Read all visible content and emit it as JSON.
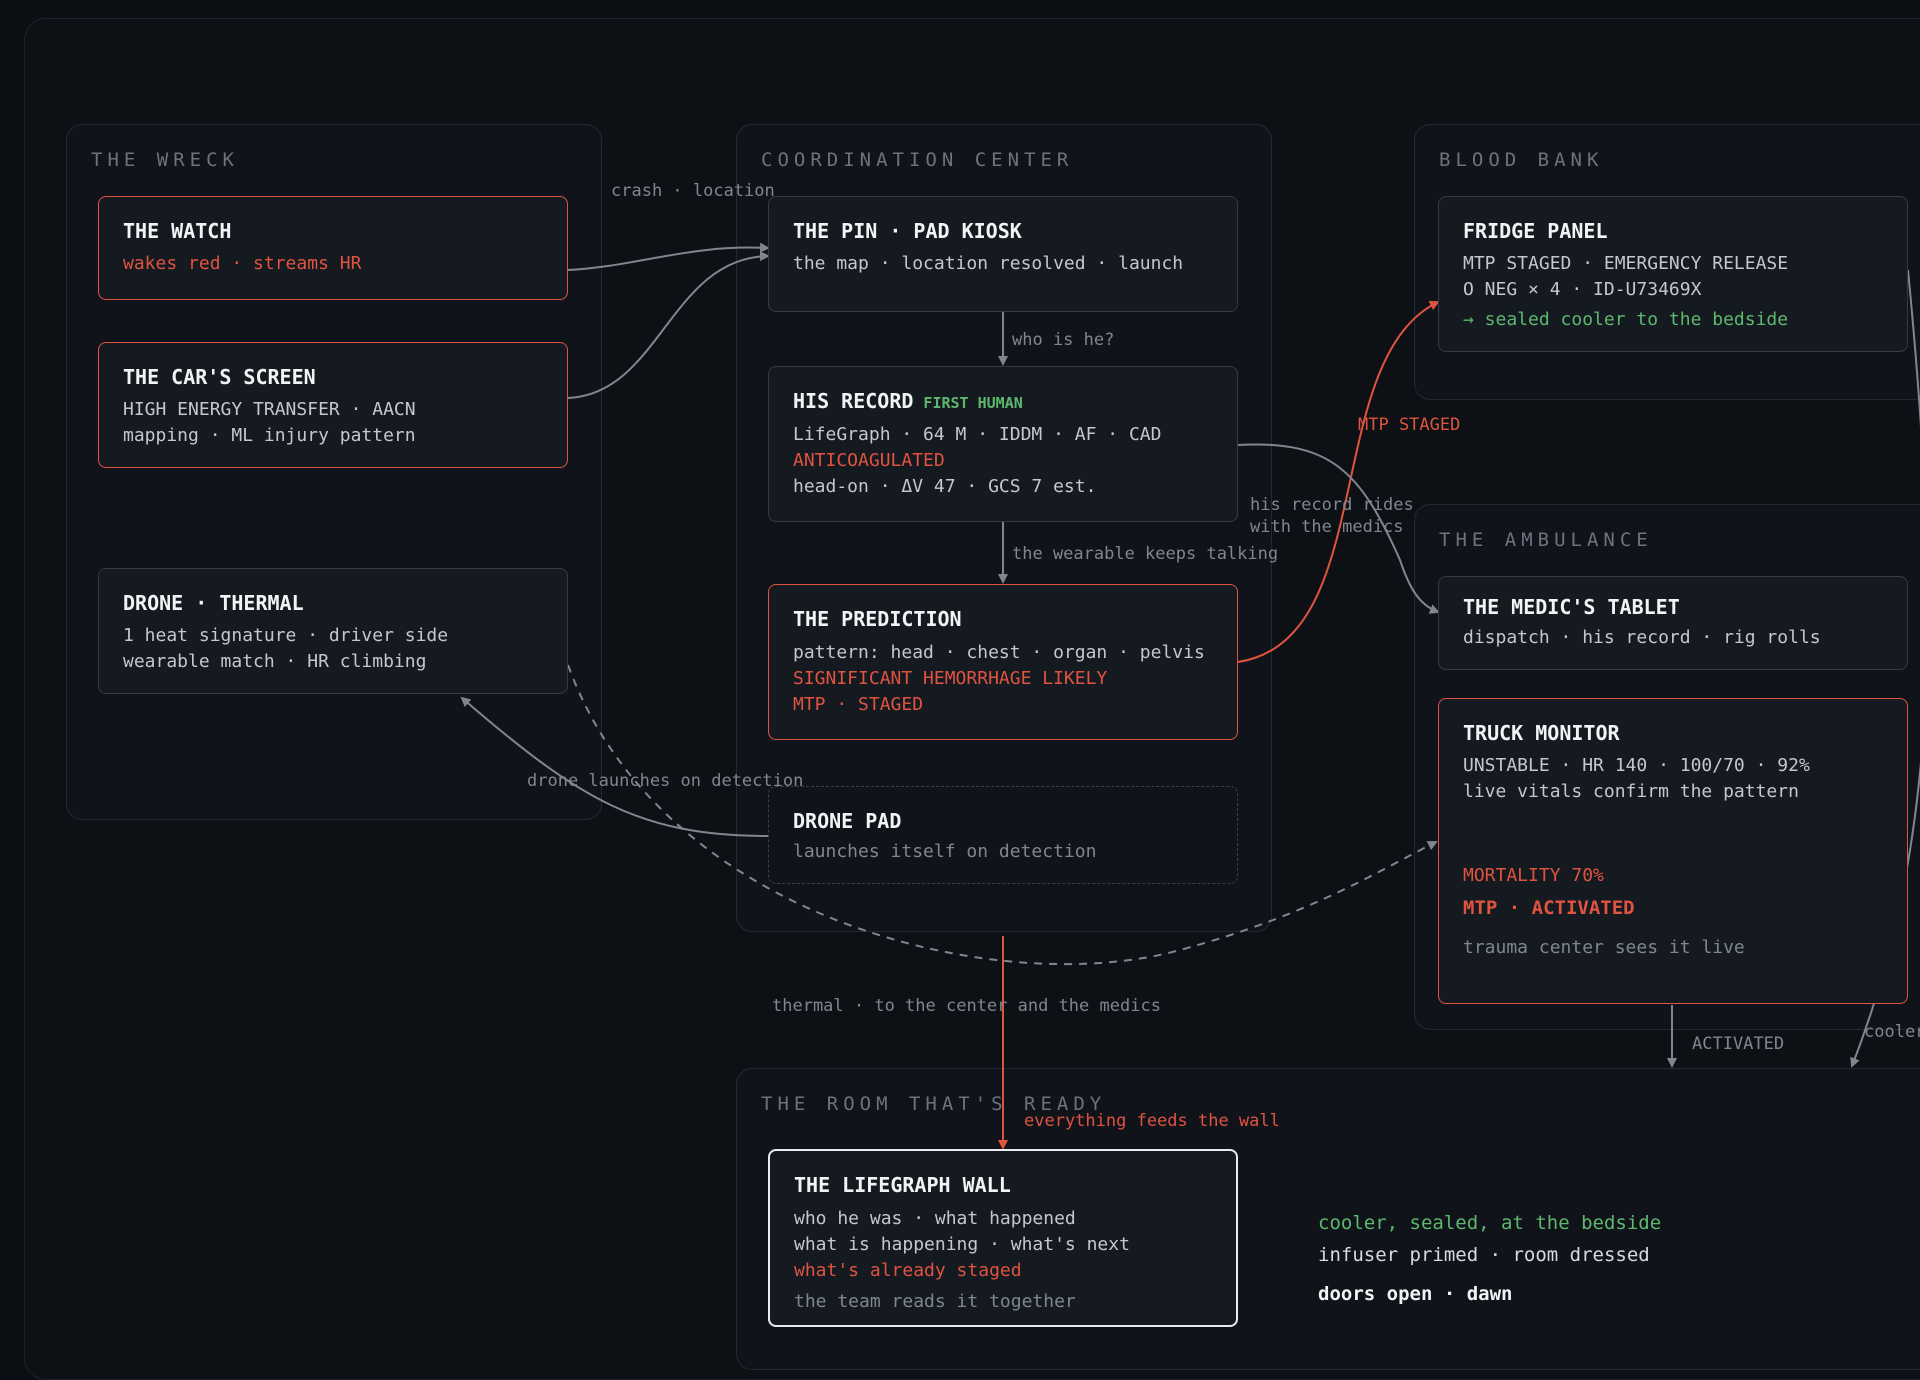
{
  "groups": {
    "wreck": "THE WRECK",
    "coordination": "COORDINATION CENTER",
    "blood_bank": "BLOOD BANK",
    "ambulance": "THE AMBULANCE",
    "room": "THE ROOM THAT'S READY"
  },
  "nodes": {
    "watch": {
      "title": "THE WATCH",
      "line1": "wakes red · streams HR"
    },
    "car_screen": {
      "title": "THE CAR'S SCREEN",
      "line1": "HIGH ENERGY TRANSFER · AACN",
      "line2": "mapping · ML injury pattern"
    },
    "drone_thermal": {
      "title": "DRONE · THERMAL",
      "line1": "1 heat signature · driver side",
      "line2": "wearable match · HR climbing"
    },
    "pin_kiosk": {
      "title": "THE PIN · PAD KIOSK",
      "line1": "the map · location resolved · launch"
    },
    "his_record": {
      "title": "HIS RECORD",
      "tag": "FIRST HUMAN",
      "line1": "LifeGraph · 64 M · IDDM · AF · CAD",
      "line2": "ANTICOAGULATED",
      "line3": "head-on · ΔV 47 · GCS 7 est."
    },
    "prediction": {
      "title": "THE PREDICTION",
      "line1": "pattern: head · chest · organ · pelvis",
      "line2": "SIGNIFICANT HEMORRHAGE LIKELY",
      "line3": "MTP · STAGED"
    },
    "drone_pad": {
      "title": "DRONE PAD",
      "line1": "launches itself on detection"
    },
    "fridge": {
      "title": "FRIDGE PANEL",
      "line1": "MTP STAGED · EMERGENCY RELEASE",
      "line2": "O NEG × 4 · ID-U73469X",
      "line3": "→ sealed cooler to the bedside"
    },
    "medic_tablet": {
      "title": "THE MEDIC'S TABLET",
      "line1": "dispatch · his record · rig rolls"
    },
    "truck_monitor": {
      "title": "TRUCK MONITOR",
      "line1": "UNSTABLE · HR 140 · 100/70 · 92%",
      "line2": "live vitals confirm the pattern",
      "line3": "MORTALITY 70%",
      "line4": "MTP · ACTIVATED",
      "line5": "trauma center sees it live"
    },
    "lifegraph_wall": {
      "title": "THE LIFEGRAPH WALL",
      "line1": "who he was · what happened",
      "line2": "what is happening · what's next",
      "line3": "what's already staged",
      "line4": "the team reads it together"
    }
  },
  "edge_labels": {
    "crash_location": "crash · location",
    "who_is_he": "who is he?",
    "wearable": "the wearable keeps talking",
    "mtp_staged": "MTP STAGED",
    "record_rides_1": "his record rides",
    "record_rides_2": "with the medics",
    "drone_launch": "drone launches on detection",
    "thermal": "thermal · to the center and the medics",
    "everything": "everything feeds the wall",
    "activated": "ACTIVATED",
    "cooler": "cooler"
  },
  "room_notes": {
    "line1": "cooler, sealed, at the bedside",
    "line2": "infuser primed · room dressed",
    "line3": "doors open · dawn"
  },
  "colors": {
    "red": "#e0533f",
    "green": "#5db86e",
    "gray": "#80868f"
  }
}
